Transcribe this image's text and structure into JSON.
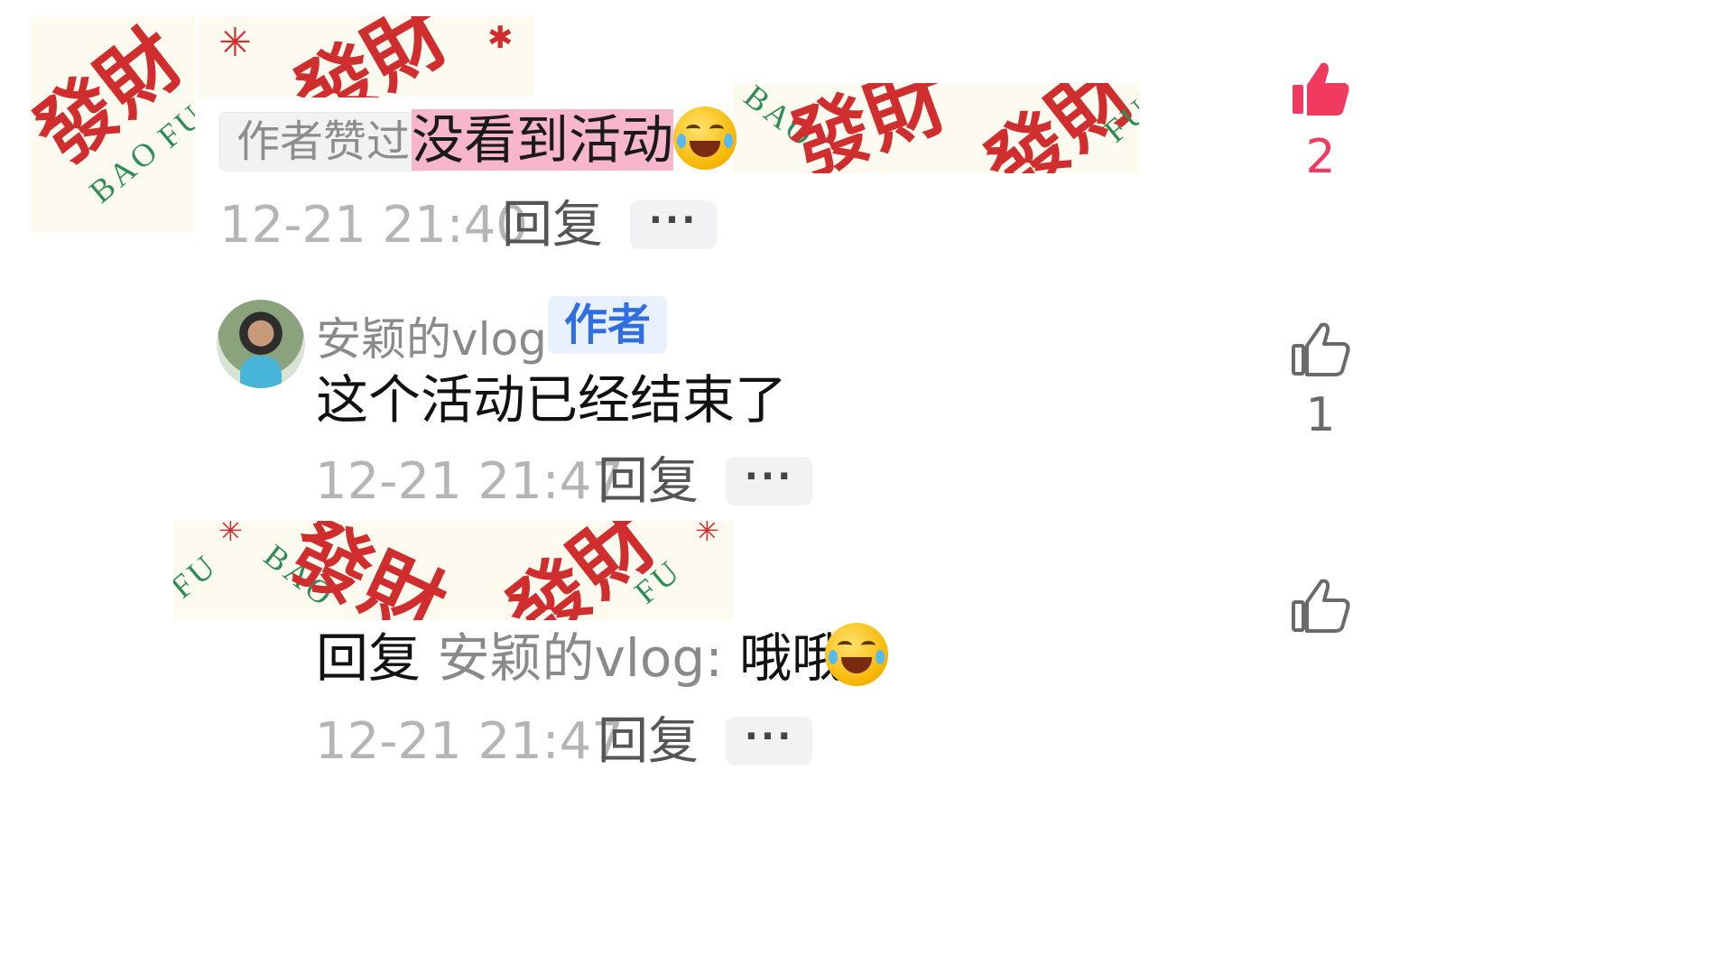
{
  "comments": [
    {
      "badge": "作者赞过",
      "text": "没看到活动",
      "emoji": "laughing-crying-emoji",
      "time": "12-21 21:40",
      "reply_label": "回复",
      "more_label": "···",
      "likes": "2",
      "liked": true
    },
    {
      "author": "安颖的vlog",
      "author_badge": "作者",
      "text": "这个活动已经结束了",
      "time": "12-21 21:47",
      "reply_label": "回复",
      "more_label": "···",
      "likes": "1",
      "liked": false
    },
    {
      "reply_prefix": "回复",
      "reply_target": "安颖的vlog:",
      "text": "哦哦",
      "emoji": "laughing-crying-emoji",
      "time": "12-21 21:47",
      "reply_label": "回复",
      "more_label": "···",
      "likes": "",
      "liked": false
    }
  ],
  "stickers": {
    "main": "發財",
    "latin_1": "BAO",
    "latin_2": "FU"
  },
  "colors": {
    "liked": "#f03a5f",
    "unliked": "#6a6a6a",
    "highlight": "#f7b6cd",
    "author_badge": "#2f6fe0"
  }
}
